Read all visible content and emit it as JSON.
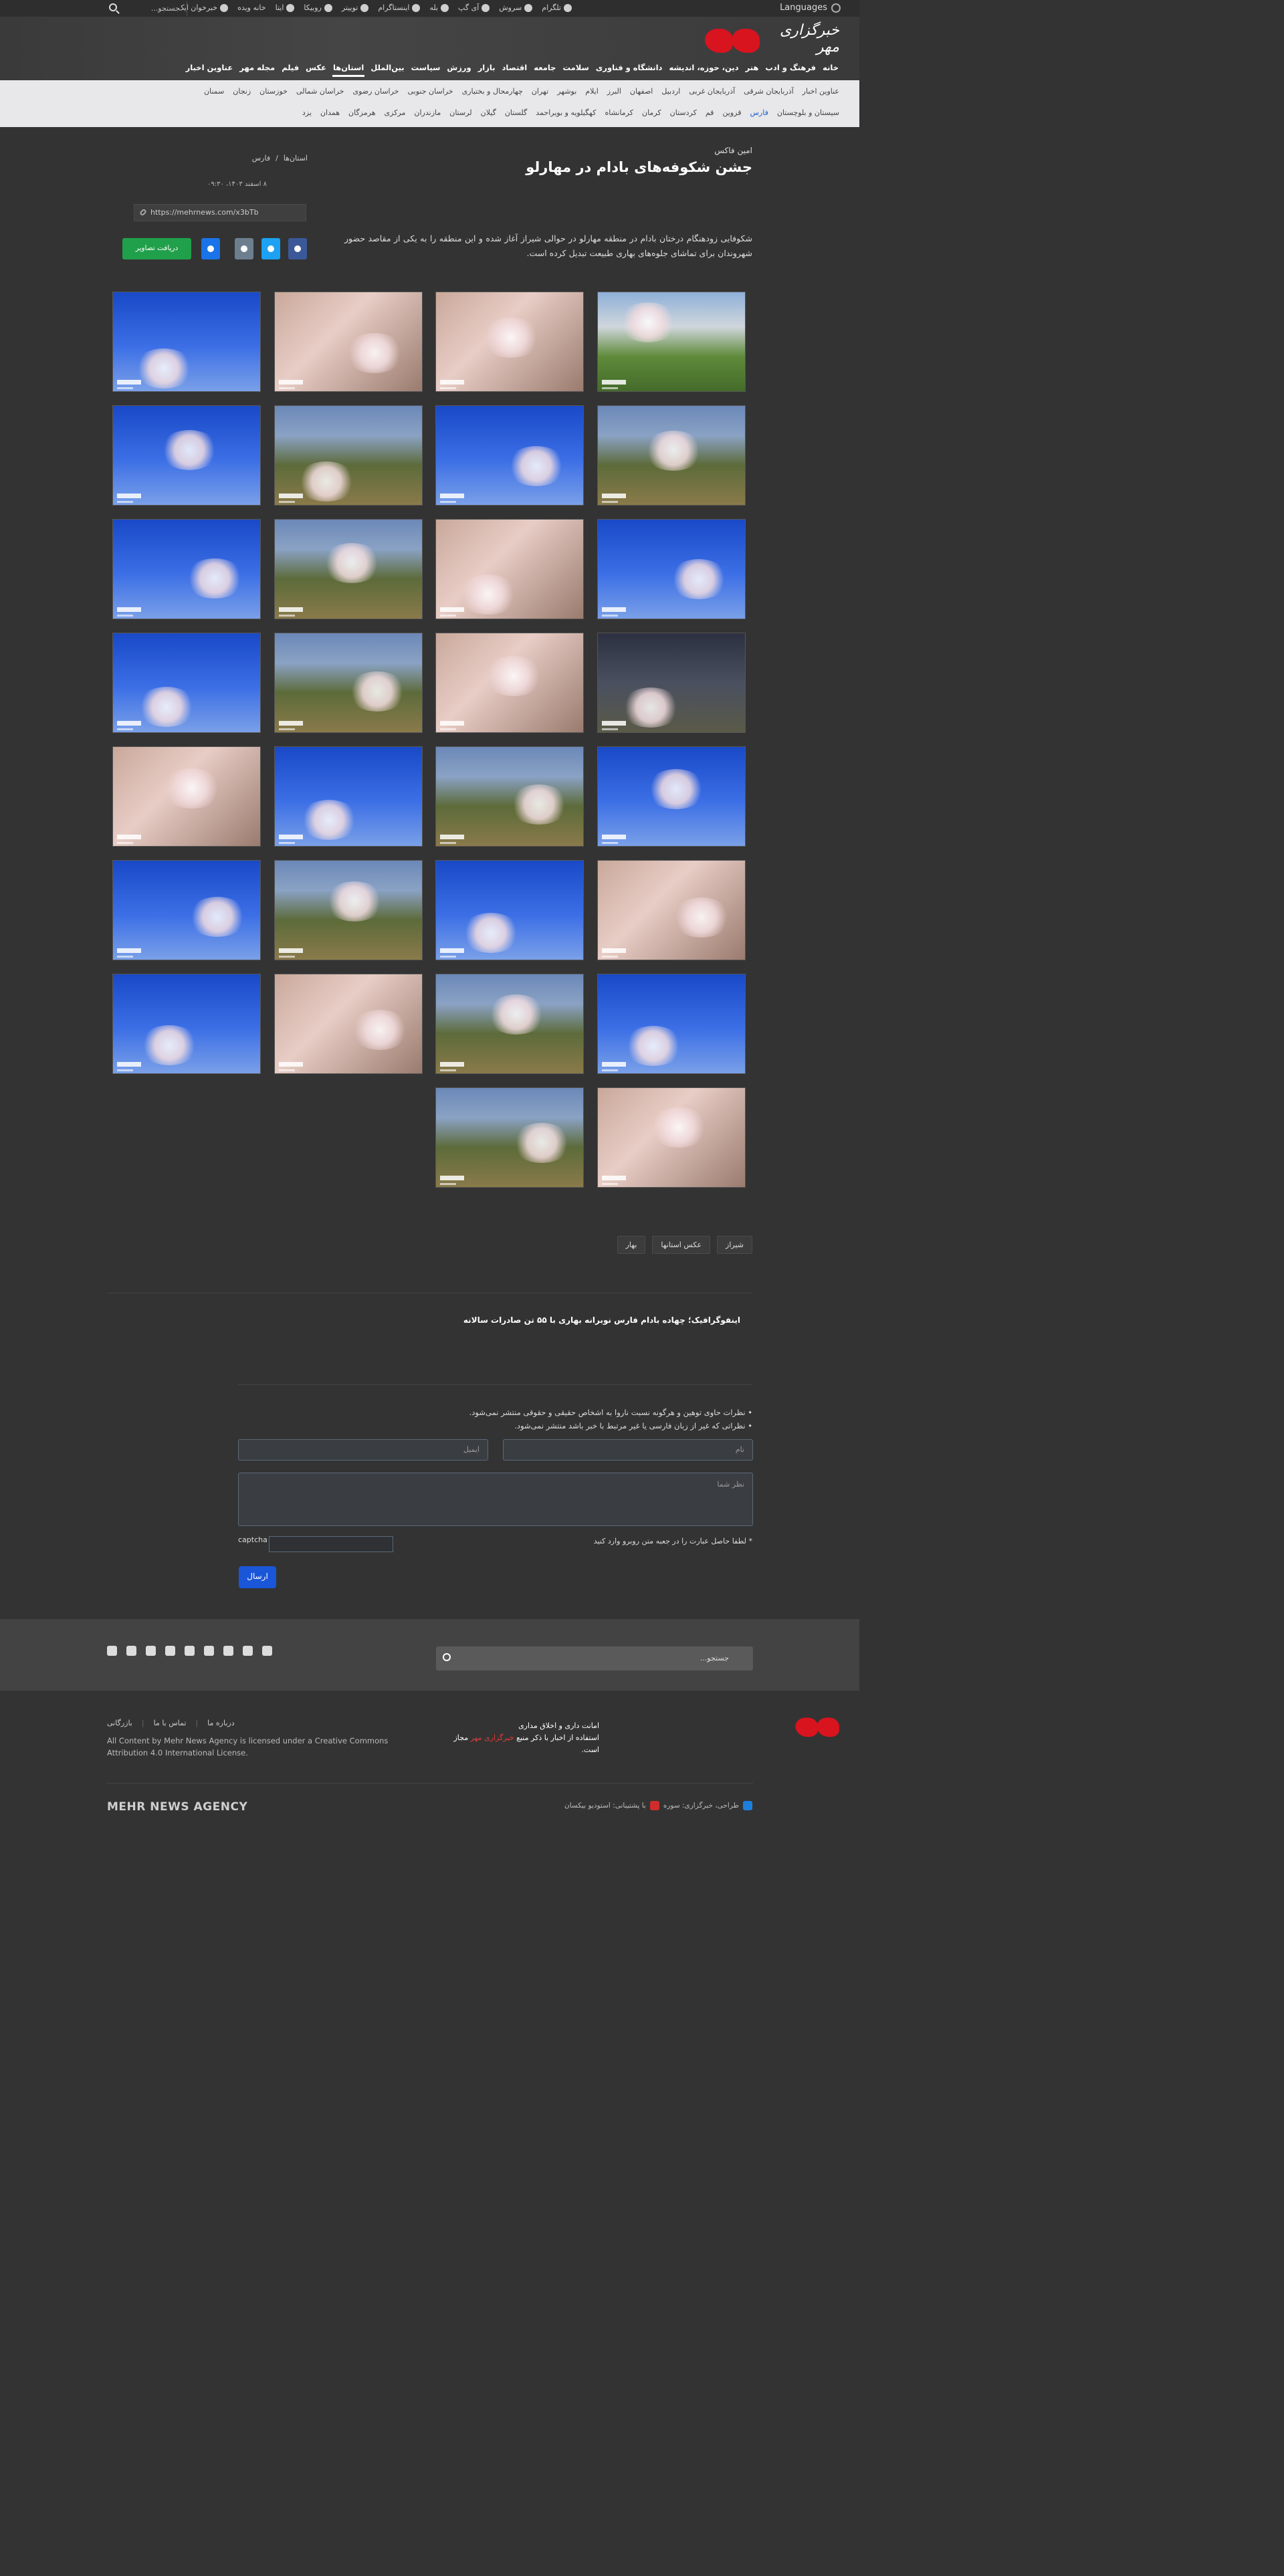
{
  "topbar": {
    "languages": "Languages",
    "search_placeholder": "جستجو...",
    "social": [
      "تلگرام",
      "سروش",
      "آی گپ",
      "بله",
      "اینستاگرام",
      "توییتر",
      "روبیکا",
      "ایتا",
      "خانه ویده",
      "خبرخوان ایک"
    ]
  },
  "header": {
    "logo_text": "خبرگزاری مهر",
    "nav": [
      "خانه",
      "فرهنگ و ادب",
      "هنر",
      "دین، حوزه، اندیشه",
      "دانشگاه و فناوری",
      "سلامت",
      "جامعه",
      "اقتصاد",
      "بازار",
      "ورزش",
      "سیاست",
      "بین‌الملل",
      "استان‌ها",
      "عکس",
      "فیلم",
      "مجله مهر",
      "عناوین اخبار"
    ],
    "active_nav": "استان‌ها"
  },
  "subnav": {
    "row1": [
      "عناوین اخبار",
      "آذربایجان شرقی",
      "آذربایجان غربی",
      "اردبیل",
      "اصفهان",
      "البرز",
      "ایلام",
      "بوشهر",
      "تهران",
      "چهارمحال و بختیاری",
      "خراسان جنوبی",
      "خراسان رضوی",
      "خراسان شمالی",
      "خوزستان",
      "زنجان",
      "سمنان"
    ],
    "row2": [
      "سیستان و بلوچستان",
      "فارس",
      "قزوین",
      "قم",
      "کردستان",
      "کرمان",
      "کرمانشاه",
      "کهگیلویه و بویراحمد",
      "گلستان",
      "گیلان",
      "لرستان",
      "مازندران",
      "مرکزی",
      "هرمزگان",
      "همدان",
      "یزد"
    ],
    "highlight": "فارس"
  },
  "article": {
    "kicker": "امین فاکس",
    "title": "جشن شکوفه‌های بادام در مهارلو",
    "lead": "شکوفایی زودهنگام درختان بادام در منطقه مهارلو در حوالی شیراز آغاز شده و این منطقه را به یکی از مقاصد حضور شهروندان برای تماشای جلوه‌های بهاری طبیعت تبدیل کرده است.",
    "breadcrumb": [
      "استان‌ها",
      "فارس"
    ],
    "date": "۸ اسفند ۱۴۰۳، ۰۹:۳۰",
    "short_link": "https://mehrnews.com/x3bTb",
    "get_pictures": "دریافت تصاویر"
  },
  "gallery": {
    "count": 30,
    "watermark": "MEHR"
  },
  "tags": [
    "شیراز",
    "عکس استانها",
    "بهار"
  ],
  "related": "اینفوگرافیک؛ چهاده بادام فارس نوبرانه بهاری با ۵۵ تن صادرات سالانه",
  "comments": {
    "rules": [
      "نظرات حاوی توهین و هرگونه نسبت ناروا به اشخاص حقیقی و حقوقی منتشر نمی‌شود.",
      "نظراتی که غیر از زبان فارسی یا غیر مرتبط با خبر باشد منتشر نمی‌شود."
    ],
    "name_placeholder": "نام",
    "email_placeholder": "ایمیل",
    "comment_placeholder": "نظر شما",
    "captcha_label": "* لطفا حاصل عبارت را در جعبه متن روبرو وارد کنید",
    "captcha_alt": "captcha",
    "send": "ارسال"
  },
  "footer": {
    "search_placeholder": "جستجو...",
    "motto_line1": "امانت داری و اخلاق مداری",
    "motto_line2": "استفاده از اخبار با ذکر منبع",
    "motto_red": "خبرگزاری مهر",
    "motto_end": "مجاز است.",
    "links": [
      "درباره ما",
      "تماس با ما",
      "بازرگانی"
    ],
    "license": "All Content by Mehr News Agency is licensed under a Creative Commons Attribution 4.0 International License.",
    "brand": "MEHR NEWS AGENCY",
    "credit_design": "طراحی، خبرگزاری: سوره",
    "credit_tech": "با پشتیبانی: استودیو بیکسان",
    "colors": {
      "brand_red": "#d8141f",
      "accent_blue": "#1a56d8",
      "green": "#20a04a"
    }
  }
}
